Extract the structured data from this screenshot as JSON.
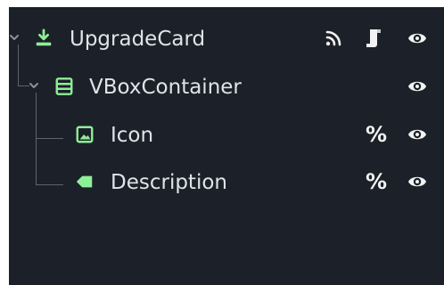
{
  "scene_tree": {
    "nodes": [
      {
        "label": "UpgradeCard",
        "type_icon": "control-node-icon",
        "row_icons": [
          "signal-icon",
          "script-icon",
          "visibility-icon"
        ]
      },
      {
        "label": "VBoxContainer",
        "type_icon": "vbox-container-icon",
        "row_icons": [
          "visibility-icon"
        ]
      },
      {
        "label": "Icon",
        "type_icon": "texture-rect-icon",
        "row_icons": [
          "unique-name-icon",
          "visibility-icon"
        ],
        "unique_marker": "%"
      },
      {
        "label": "Description",
        "type_icon": "label-node-icon",
        "row_icons": [
          "unique-name-icon",
          "visibility-icon"
        ],
        "unique_marker": "%"
      }
    ]
  },
  "colors": {
    "panel_bg": "#1c2028",
    "text": "#dfe3ea",
    "node_green": "#8eef97",
    "icon_white": "#f2f2f2",
    "guide_lines": "#5d6470"
  }
}
